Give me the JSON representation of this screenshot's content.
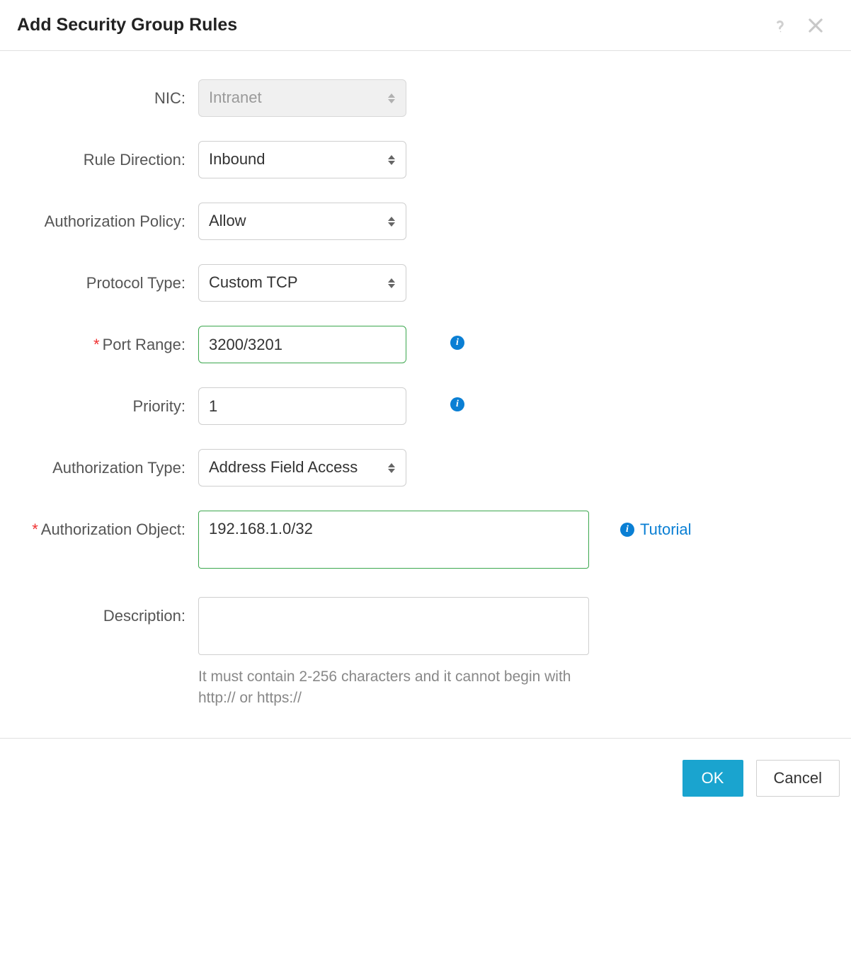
{
  "header": {
    "title": "Add Security Group Rules"
  },
  "form": {
    "nic": {
      "label": "NIC:",
      "value": "Intranet"
    },
    "rule_direction": {
      "label": "Rule Direction:",
      "value": "Inbound"
    },
    "auth_policy": {
      "label": "Authorization Policy:",
      "value": "Allow"
    },
    "protocol_type": {
      "label": "Protocol Type:",
      "value": "Custom TCP"
    },
    "port_range": {
      "label": "Port Range:",
      "value": "3200/3201"
    },
    "priority": {
      "label": "Priority:",
      "value": "1"
    },
    "auth_type": {
      "label": "Authorization Type:",
      "value": "Address Field Access"
    },
    "auth_object": {
      "label": "Authorization Object:",
      "value": "192.168.1.0/32",
      "tutorial_label": "Tutorial"
    },
    "description": {
      "label": "Description:",
      "value": "",
      "helper": "It must contain 2-256 characters and it cannot begin with http:// or https://"
    }
  },
  "footer": {
    "ok_label": "OK",
    "cancel_label": "Cancel"
  }
}
